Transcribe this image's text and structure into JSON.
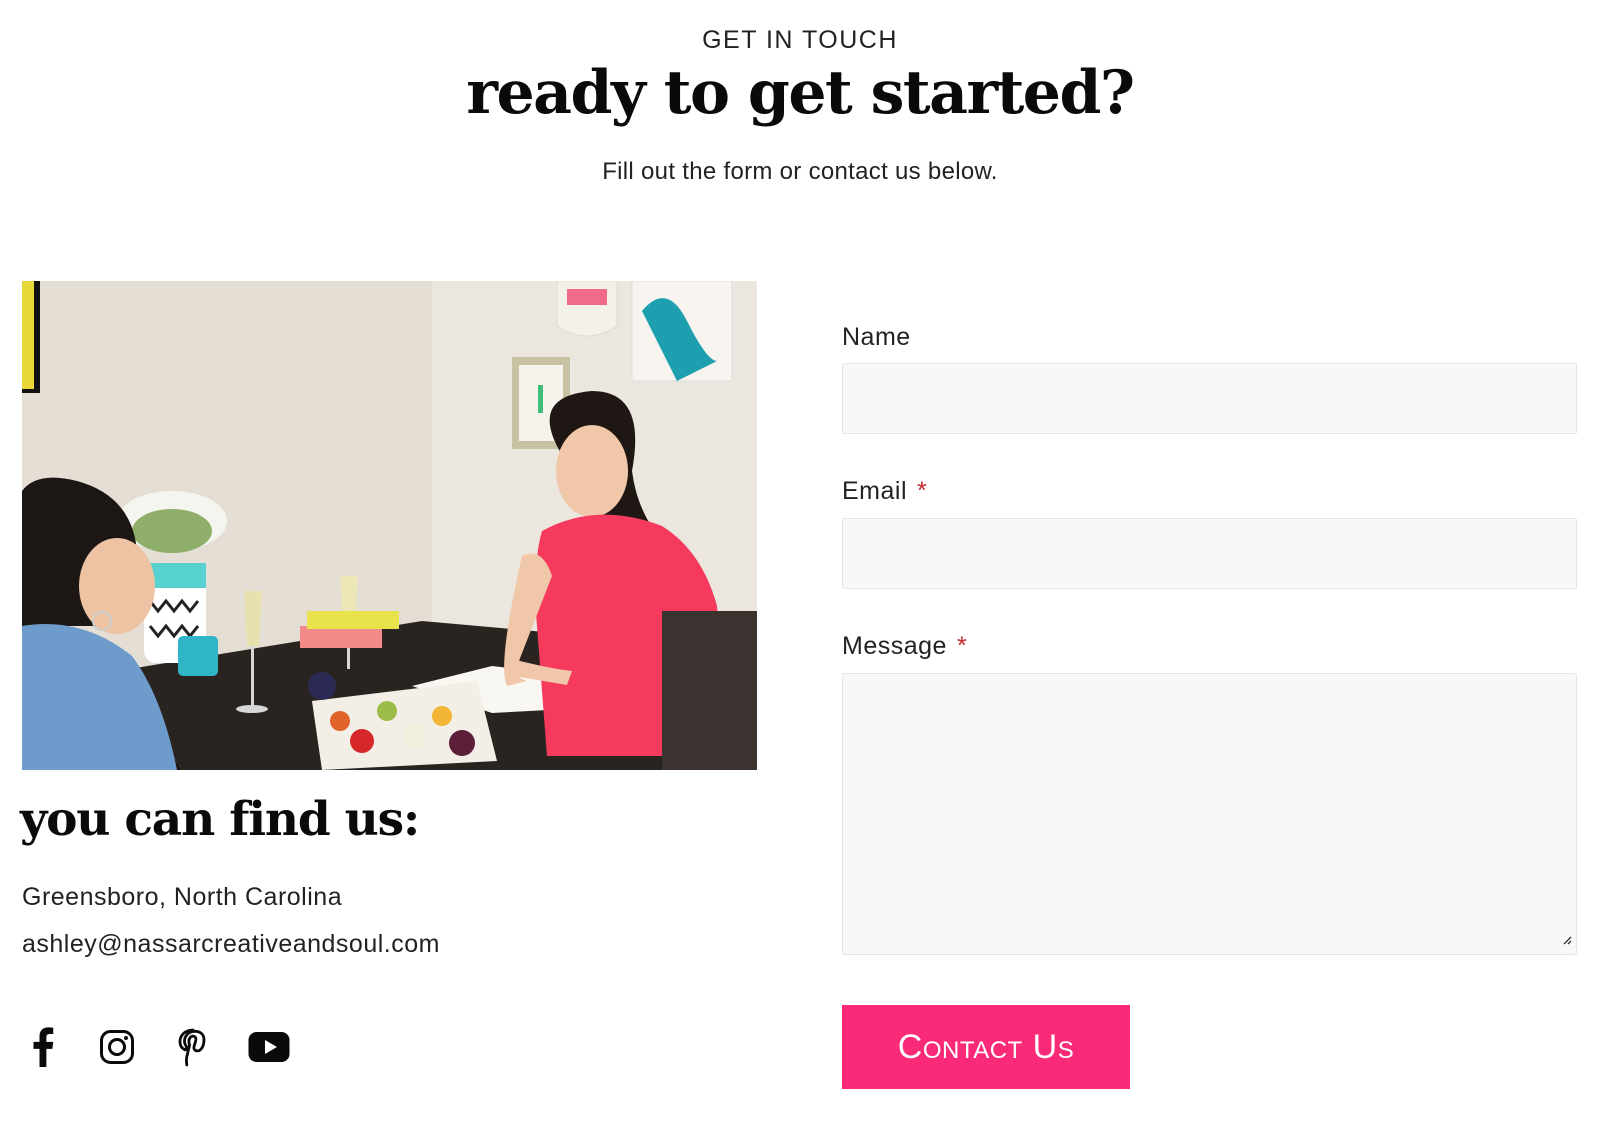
{
  "header": {
    "eyebrow": "GET IN TOUCH",
    "title": "ready to get started?",
    "subtitle": "Fill out the form or contact us below."
  },
  "contact": {
    "heading": "you can find us:",
    "location": "Greensboro, North Carolina",
    "email": "ashley@nassarcreativeandsoul.com"
  },
  "social": [
    {
      "icon": "facebook-icon"
    },
    {
      "icon": "instagram-icon"
    },
    {
      "icon": "pinterest-icon"
    },
    {
      "icon": "youtube-icon"
    }
  ],
  "form": {
    "name_label": "Name",
    "email_label": "Email",
    "message_label": "Message",
    "required_mark": "*",
    "name_value": "",
    "email_value": "",
    "message_value": "",
    "submit_label": "Contact Us"
  },
  "colors": {
    "accent": "#fb2a78",
    "required": "#c62828",
    "field_bg": "#f8f8f8"
  }
}
